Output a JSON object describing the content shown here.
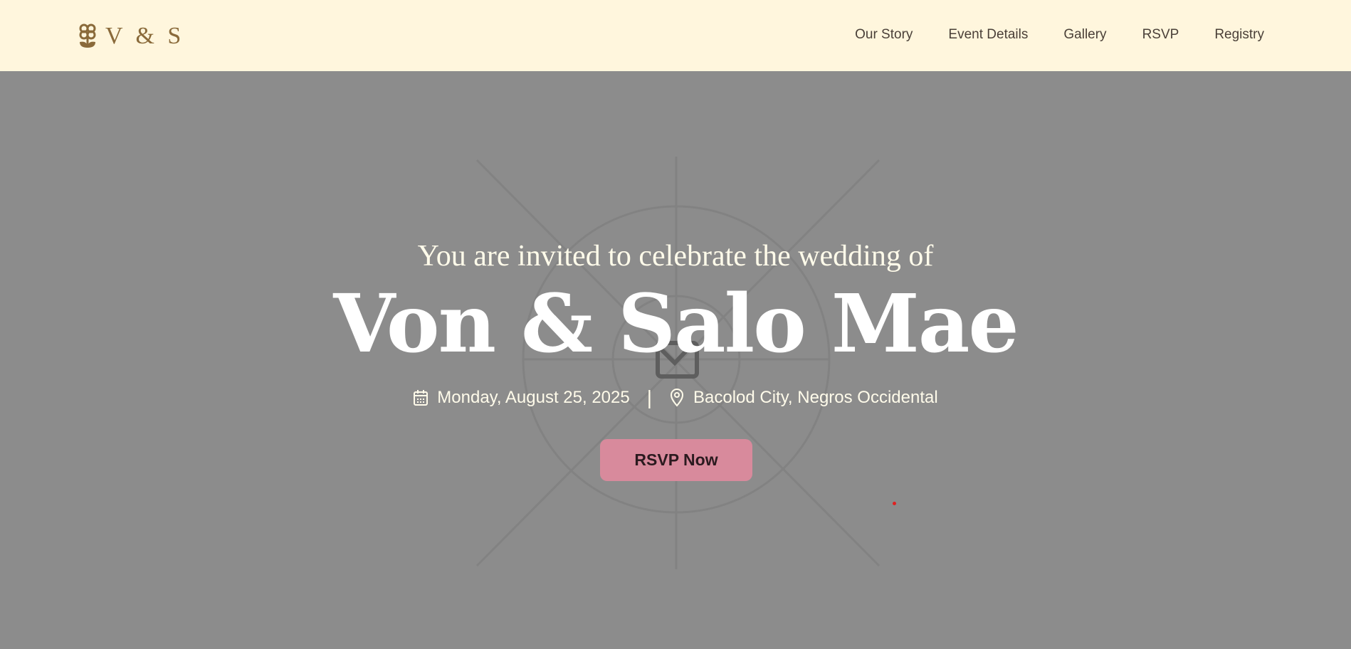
{
  "header": {
    "logo_text": "V & S",
    "nav": [
      {
        "label": "Our Story"
      },
      {
        "label": "Event Details"
      },
      {
        "label": "Gallery"
      },
      {
        "label": "RSVP"
      },
      {
        "label": "Registry"
      }
    ]
  },
  "hero": {
    "subtitle": "You are invited to celebrate the wedding of",
    "title": "Von & Salo Mae",
    "date": "Monday, August 25, 2025",
    "separator": "|",
    "location": "Bacolod City, Negros Occidental",
    "cta_label": "RSVP Now"
  },
  "colors": {
    "header_bg": "#fff6dd",
    "brand": "#8a6a3a",
    "hero_bg": "#8c8c8c",
    "cta": "#d88a9c"
  }
}
